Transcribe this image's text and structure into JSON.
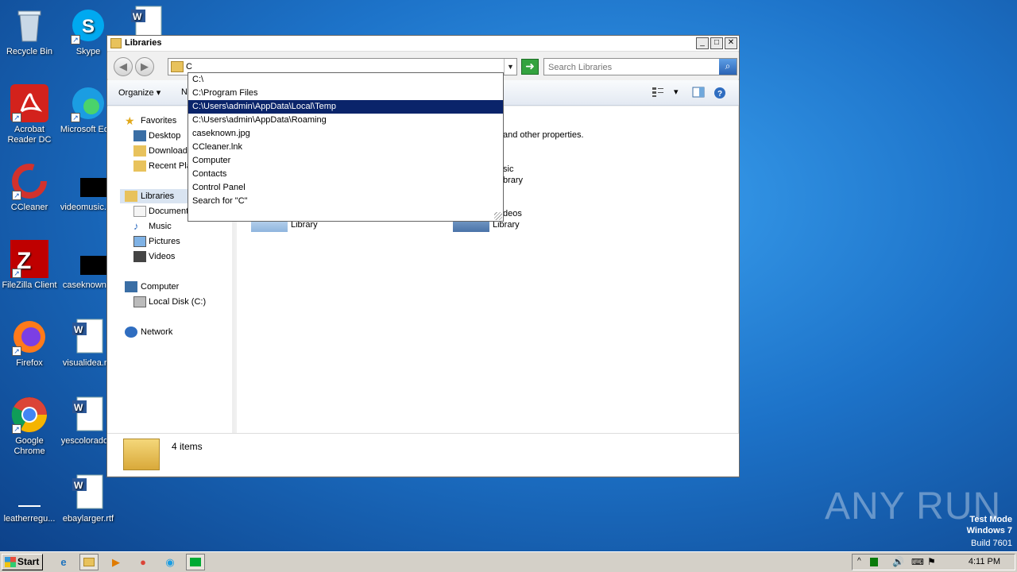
{
  "desktop": {
    "icons": [
      {
        "label": "Recycle Bin"
      },
      {
        "label": "Skype"
      },
      {
        "label": "Acrobat Reader DC"
      },
      {
        "label": "Microsoft Ed..."
      },
      {
        "label": "CCleaner"
      },
      {
        "label": "videomusic.r..."
      },
      {
        "label": "FileZilla Client"
      },
      {
        "label": "caseknown..."
      },
      {
        "label": "Firefox"
      },
      {
        "label": "visualidea.r..."
      },
      {
        "label": "Google Chrome"
      },
      {
        "label": "yescolorado..."
      },
      {
        "label": "leatherregu..."
      },
      {
        "label": "ebaylarger.rtf"
      }
    ]
  },
  "window": {
    "title": "Libraries",
    "address_value": "C",
    "search_placeholder": "Search Libraries",
    "toolbar": {
      "organize": "Organize",
      "new": "N"
    },
    "nav": {
      "favorites": "Favorites",
      "desktop": "Desktop",
      "downloads": "Downloads",
      "recent": "Recent Pla",
      "libraries": "Libraries",
      "documents": "Document",
      "music": "Music",
      "pictures": "Pictures",
      "videos": "Videos",
      "computer": "Computer",
      "local_disk": "Local Disk (C:)",
      "network": "Network"
    },
    "content": {
      "hint": "and other properties.",
      "music_partial": "sic",
      "music_lib": "brary",
      "videos_partial": "deos",
      "videos_lib": "Library",
      "left_lib": "Library"
    },
    "status": "4 items"
  },
  "autocomplete": {
    "items": [
      "C:\\",
      "C:\\Program Files",
      "C:\\Users\\admin\\AppData\\Local\\Temp",
      "C:\\Users\\admin\\AppData\\Roaming",
      "caseknown.jpg",
      "CCleaner.lnk",
      "Computer",
      "Contacts",
      "Control Panel",
      "Search for \"C\""
    ],
    "selected_index": 2
  },
  "taskbar": {
    "start": "Start",
    "clock": "4:11 PM"
  },
  "watermark": {
    "brand": "ANY RUN",
    "line1": "Test Mode",
    "line2": "Windows 7",
    "line3": "Build 7601"
  }
}
